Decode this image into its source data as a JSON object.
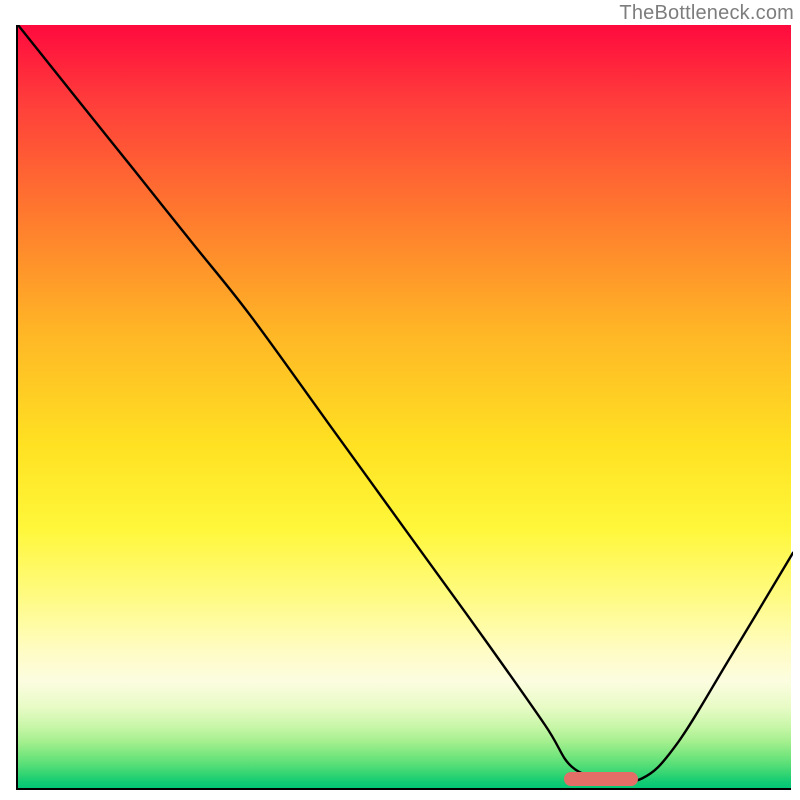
{
  "watermark": "TheBottleneck.com",
  "marker": {
    "x_start_frac": 0.705,
    "x_end_frac": 0.8,
    "y_frac": 0.985,
    "color": "#e36e68"
  },
  "chart_data": {
    "type": "line",
    "title": "",
    "xlabel": "",
    "ylabel": "",
    "xlim": [
      0,
      1
    ],
    "ylim": [
      0,
      1
    ],
    "axes_visible": {
      "left": true,
      "bottom": true,
      "ticks": false,
      "labels": false
    },
    "background_gradient": [
      {
        "stop": 0.0,
        "color": "#ff0a3e"
      },
      {
        "stop": 0.25,
        "color": "#ff7a2e"
      },
      {
        "stop": 0.55,
        "color": "#ffe122"
      },
      {
        "stop": 0.82,
        "color": "#fffcc4"
      },
      {
        "stop": 0.92,
        "color": "#c7f6a7"
      },
      {
        "stop": 1.0,
        "color": "#02c776"
      }
    ],
    "series": [
      {
        "name": "curve",
        "x": [
          0.0,
          0.075,
          0.15,
          0.225,
          0.3,
          0.4,
          0.5,
          0.6,
          0.68,
          0.715,
          0.76,
          0.805,
          0.85,
          0.92,
          1.0
        ],
        "y": [
          1.0,
          0.905,
          0.81,
          0.715,
          0.62,
          0.48,
          0.34,
          0.2,
          0.085,
          0.03,
          0.015,
          0.015,
          0.06,
          0.175,
          0.31
        ]
      }
    ],
    "annotations": [
      {
        "type": "pill",
        "x_start": 0.705,
        "x_end": 0.8,
        "y": 0.015,
        "color": "#e36e68"
      }
    ]
  }
}
